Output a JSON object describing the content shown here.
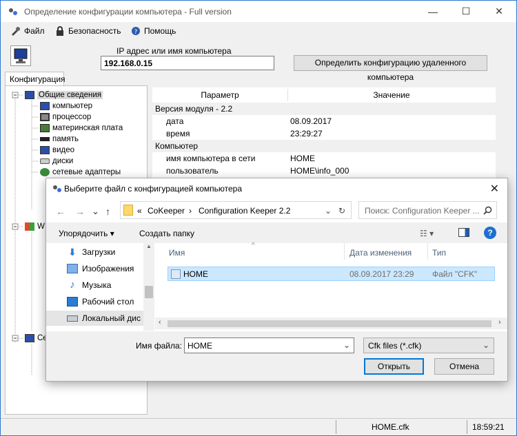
{
  "window": {
    "title": "Определение конфигурации компьютера - Full version",
    "minimize": "—",
    "maximize": "☐",
    "close": "✕"
  },
  "menu": {
    "file": "Файл",
    "security": "Безопасность",
    "help": "Помощь"
  },
  "ip": {
    "label": "IP адрес или имя компьютера",
    "value": "192.168.0.15",
    "remote_button": "Определить конфигурацию удаленного компьютера"
  },
  "tabs": {
    "config": "Конфигурация"
  },
  "tree": {
    "items": [
      {
        "label": "Общие сведения",
        "selected": true
      },
      {
        "label": "компьютер"
      },
      {
        "label": "процессор"
      },
      {
        "label": "материнская плата"
      },
      {
        "label": "память"
      },
      {
        "label": "видео"
      },
      {
        "label": "диски"
      },
      {
        "label": "сетевые адаптеры"
      }
    ],
    "partial_w": "W",
    "partial_se": "Се"
  },
  "grid": {
    "col_param": "Параметр",
    "col_value": "Значение",
    "group_module": "Версия модуля - 2.2",
    "date_label": "дата",
    "date_value": "08.09.2017",
    "time_label": "время",
    "time_value": "23:29:27",
    "group_computer": "Компьютер",
    "netname_label": "имя компьютера в сети",
    "netname_value": "HOME",
    "user_label": "пользователь",
    "user_value": "HOME\\info_000"
  },
  "status": {
    "file": "HOME.cfk",
    "time": "18:59:21"
  },
  "dialog": {
    "title": "Выберите файл с конфигурацией компьютера",
    "close": "✕",
    "addr_prefix": "«",
    "addr_part1": "CoKeeper",
    "addr_sep": "›",
    "addr_part2": "Configuration Keeper 2.2",
    "search_placeholder": "Поиск: Configuration Keeper ...",
    "organize": "Упорядочить",
    "new_folder": "Создать папку",
    "nav": [
      {
        "label": "Загрузки",
        "color": "#2b7cd3"
      },
      {
        "label": "Изображения",
        "color": "#3b86d6"
      },
      {
        "label": "Музыка",
        "color": "#2b7cd3"
      },
      {
        "label": "Рабочий стол",
        "color": "#2b7cd3"
      },
      {
        "label": "Локальный дис",
        "color": "#5a6b80"
      }
    ],
    "col_name": "Имя",
    "col_date": "Дата изменения",
    "col_type": "Тип",
    "file_name": "HOME",
    "file_date": "08.09.2017 23:29",
    "file_type": "Файл \"CFK\"",
    "filename_label": "Имя файла:",
    "filename_value": "HOME",
    "filetype_value": "Cfk files (*.cfk)",
    "open_button": "Открыть",
    "cancel_button": "Отмена"
  }
}
